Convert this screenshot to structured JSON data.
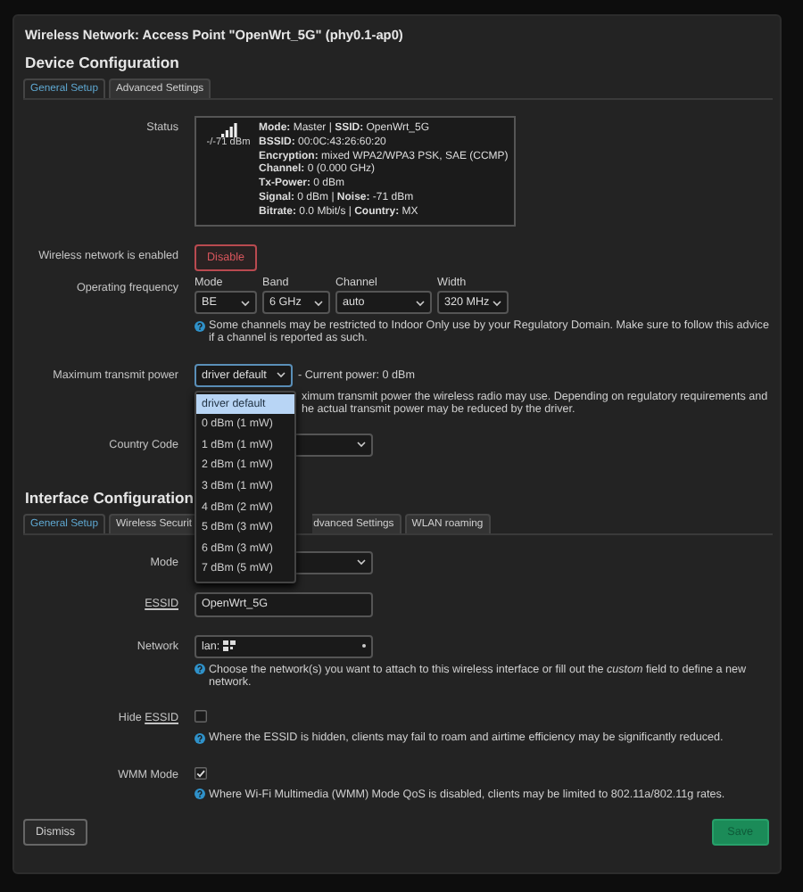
{
  "dialog": {
    "title": "Wireless Network: Access Point \"OpenWrt_5G\" (phy0.1-ap0)"
  },
  "device_configuration": {
    "heading": "Device Configuration",
    "tabs": [
      {
        "label": "General Setup",
        "selected": true
      },
      {
        "label": "Advanced Settings",
        "selected": false
      }
    ],
    "status": {
      "label": "Status",
      "reading": "-/-71 dBm",
      "lines": [
        "**Mode:** Master | **SSID:** OpenWrt_5G",
        "**BSSID:** 00:0C:43:26:60:20",
        "**Encryption:** mixed WPA2/WPA3 PSK, SAE (CCMP)",
        "**Channel:** 0 (0.000 GHz)",
        "**Tx-Power:** 0 dBm",
        "**Signal:** 0 dBm | **Noise:** -71 dBm",
        "**Bitrate:** 0.0 Mbit/s | **Country:** MX"
      ]
    },
    "enabled": {
      "label": "Wireless network is enabled",
      "button": "Disable"
    },
    "frequency": {
      "label": "Operating frequency",
      "selects": [
        {
          "label": "Mode",
          "value": "BE"
        },
        {
          "label": "Band",
          "value": "6 GHz"
        },
        {
          "label": "Channel",
          "value": "auto"
        },
        {
          "label": "Width",
          "value": "320 MHz"
        }
      ],
      "help": "Some channels may be restricted to Indoor Only use by your Regulatory Domain. Make sure to follow this advice if a channel is reported as such."
    },
    "transmit_power": {
      "label": "Maximum transmit power",
      "value": "driver default",
      "current": "- Current power: 0 dBm",
      "help_lines": [
        "ximum transmit power the wireless radio may use. Depending on regulatory requirements and",
        "he actual transmit power may be reduced by the driver."
      ],
      "options": [
        {
          "label": "driver default",
          "selected": true
        },
        {
          "label": "0 dBm (1 mW)",
          "selected": false
        },
        {
          "label": "1 dBm (1 mW)",
          "selected": false
        },
        {
          "label": "2 dBm (1 mW)",
          "selected": false
        },
        {
          "label": "3 dBm (1 mW)",
          "selected": false
        },
        {
          "label": "4 dBm (2 mW)",
          "selected": false
        },
        {
          "label": "5 dBm (3 mW)",
          "selected": false
        },
        {
          "label": "6 dBm (3 mW)",
          "selected": false
        },
        {
          "label": "7 dBm (5 mW)",
          "selected": false
        }
      ]
    },
    "country_code": {
      "label": "Country Code"
    }
  },
  "interface_configuration": {
    "heading": "Interface Configuration",
    "tabs": [
      {
        "label": "General Setup",
        "selected": true
      },
      {
        "label": "Wireless Securit",
        "selected": false
      },
      {
        "label": "dvanced Settings",
        "selected": false
      },
      {
        "label": "WLAN roaming",
        "selected": false
      }
    ],
    "mode": {
      "label": "Mode"
    },
    "essid": {
      "abbr": "ESSID",
      "value": "OpenWrt_5G"
    },
    "network": {
      "label": "Network",
      "value": "lan:",
      "help": "Choose the network(s) you want to attach to this wireless interface or fill out the *custom* field to define a new network."
    },
    "hide_essid": {
      "label": "Hide ",
      "abbr": "ESSID",
      "checked": false,
      "help": "Where the ESSID is hidden, clients may fail to roam and airtime efficiency may be significantly reduced."
    },
    "wmm_mode": {
      "label": "WMM Mode",
      "checked": true,
      "help": "Where Wi-Fi Multimedia (WMM) Mode QoS is disabled, clients may be limited to 802.11a/802.11g rates."
    }
  },
  "buttons": {
    "dismiss": "Dismiss",
    "save": "Save"
  }
}
